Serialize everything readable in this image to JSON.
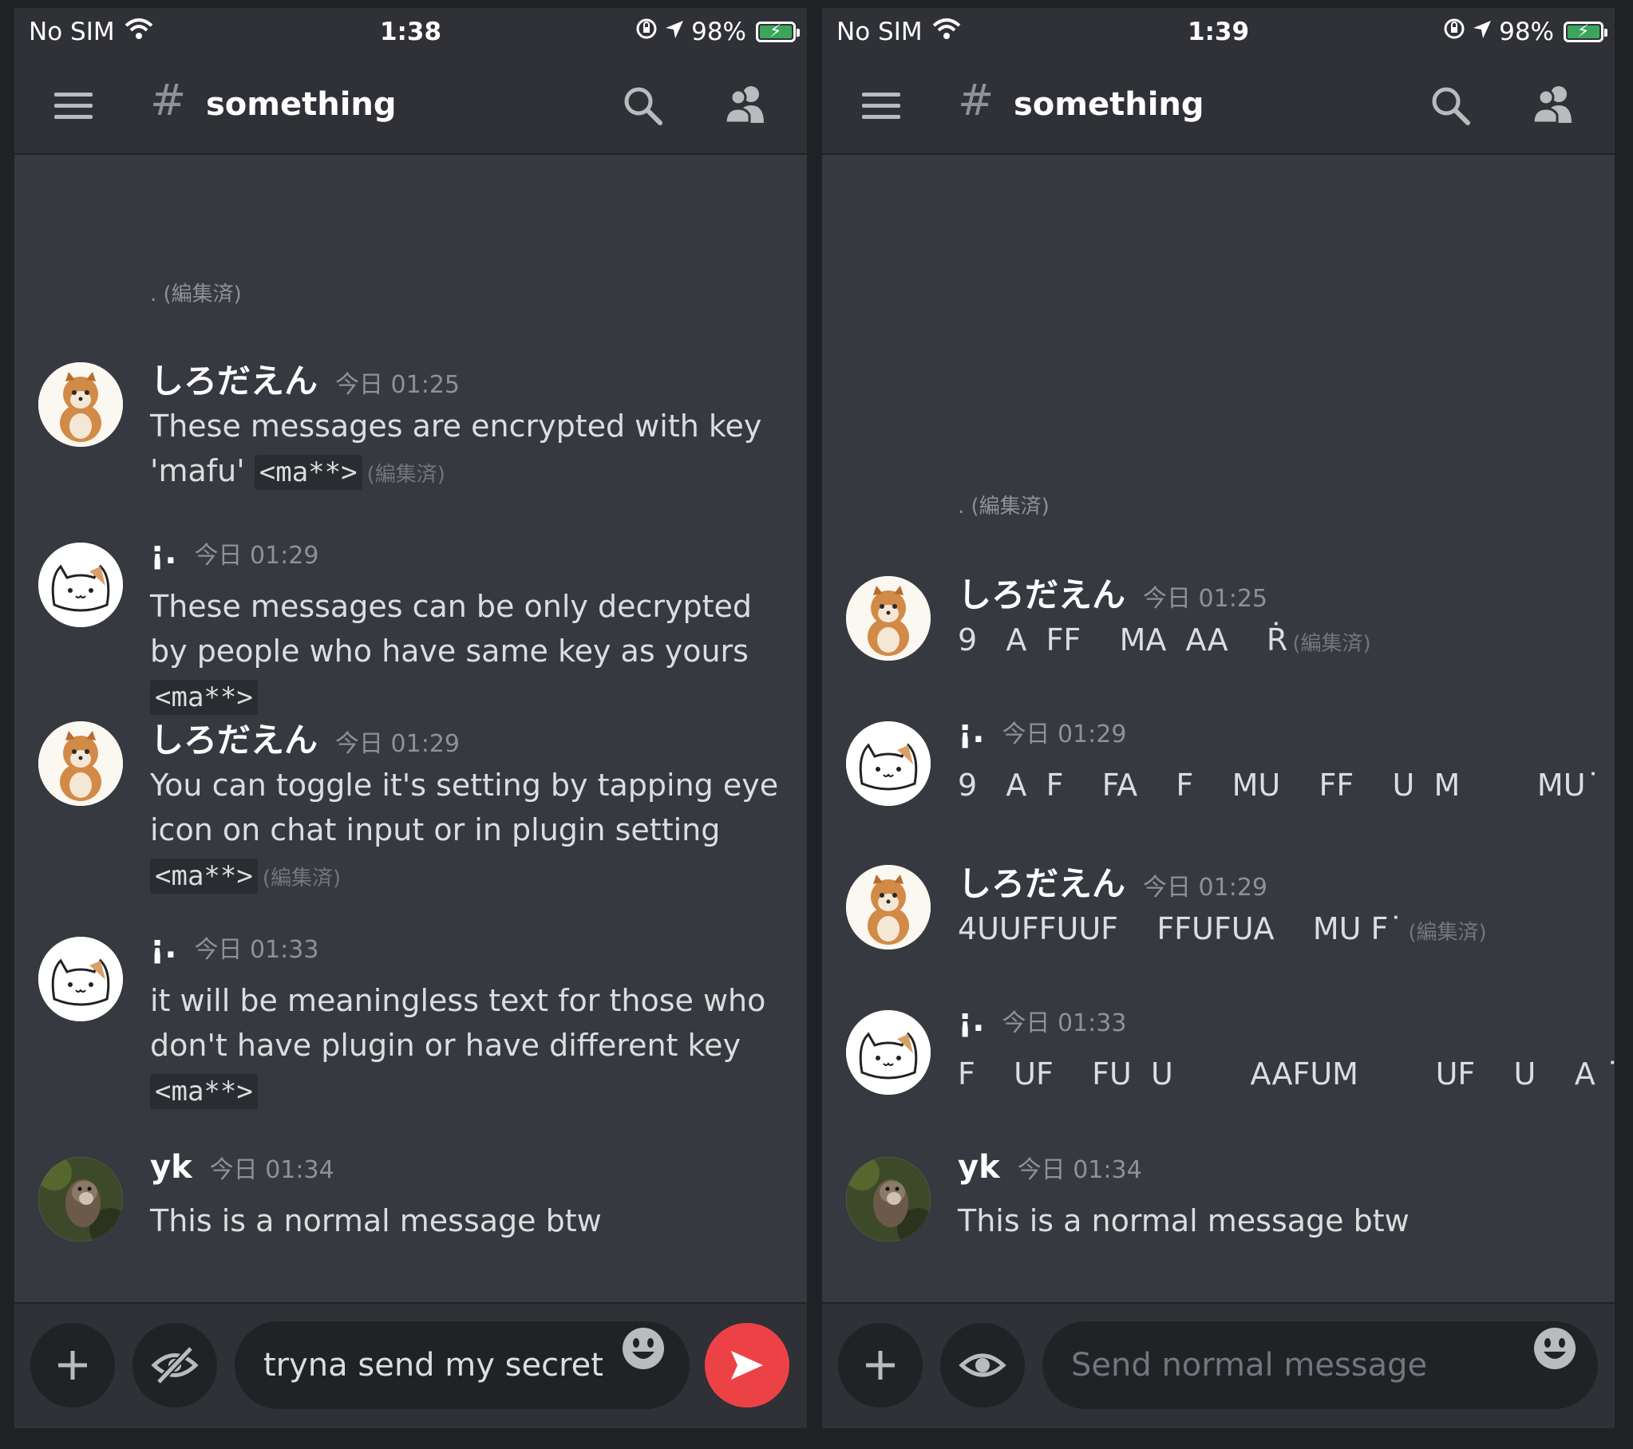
{
  "status": {
    "carrier": "No SIM",
    "battery": "98%",
    "time_left": "1:38",
    "time_right": "1:39"
  },
  "channel": {
    "title": "something"
  },
  "edited_label": "(編集済)",
  "edited_dot": ".",
  "left": {
    "messages": [
      {
        "author": "しろだえん",
        "time": "今日 01:25",
        "text": "These messages are encrypted with key 'mafu'",
        "code": "<ma**>",
        "edited": "(編集済)"
      },
      {
        "author": "¡.",
        "time": "今日 01:29",
        "text": "These messages can be only decrypted by people who have same key as yours",
        "code": "<ma**>"
      },
      {
        "author": "しろだえん",
        "time": "今日 01:29",
        "text": "You can toggle it's setting by tapping eye icon on chat input or in plugin setting",
        "code": "<ma**>",
        "edited": "(編集済)"
      },
      {
        "author": "¡.",
        "time": "今日 01:33",
        "text": "it will be meaningless text for those who don't have plugin or have different key",
        "code": "<ma**>"
      },
      {
        "author": "yk",
        "time": "今日 01:34",
        "text": "This is a normal message btw"
      }
    ],
    "input_value": "tryna send my secret"
  },
  "right": {
    "messages": [
      {
        "author": "しろだえん",
        "time": "今日 01:25",
        "text": "9   A  FF    MA  AA    Ṙ",
        "edited": "(編集済)"
      },
      {
        "author": "¡.",
        "time": "今日 01:29",
        "text": "9   A  F    FA    F    MU    FF    U  M        MU˙"
      },
      {
        "author": "しろだえん",
        "time": "今日 01:29",
        "text": "4UUFFUUF    FFUFUA    MU F˙",
        "edited": "(編集済)"
      },
      {
        "author": "¡.",
        "time": "今日 01:33",
        "text": "F    UF    FU  U        AAFUM        UF    U    A ˙"
      },
      {
        "author": "yk",
        "time": "今日 01:34",
        "text": "This is a normal message btw"
      }
    ],
    "input_placeholder": "Send normal message"
  },
  "icons": {
    "menu": "hamburger-icon",
    "hash": "hashtag-icon",
    "search": "search-icon",
    "members": "members-icon",
    "plus": "plus-icon",
    "eye_off": "eye-off-icon",
    "eye": "eye-icon",
    "emoji": "emoji-icon",
    "send": "send-icon"
  },
  "colors": {
    "background": "#36393f",
    "header": "#2f3136",
    "input": "#202225",
    "send": "#ed4245",
    "battery": "#3ba55c"
  }
}
